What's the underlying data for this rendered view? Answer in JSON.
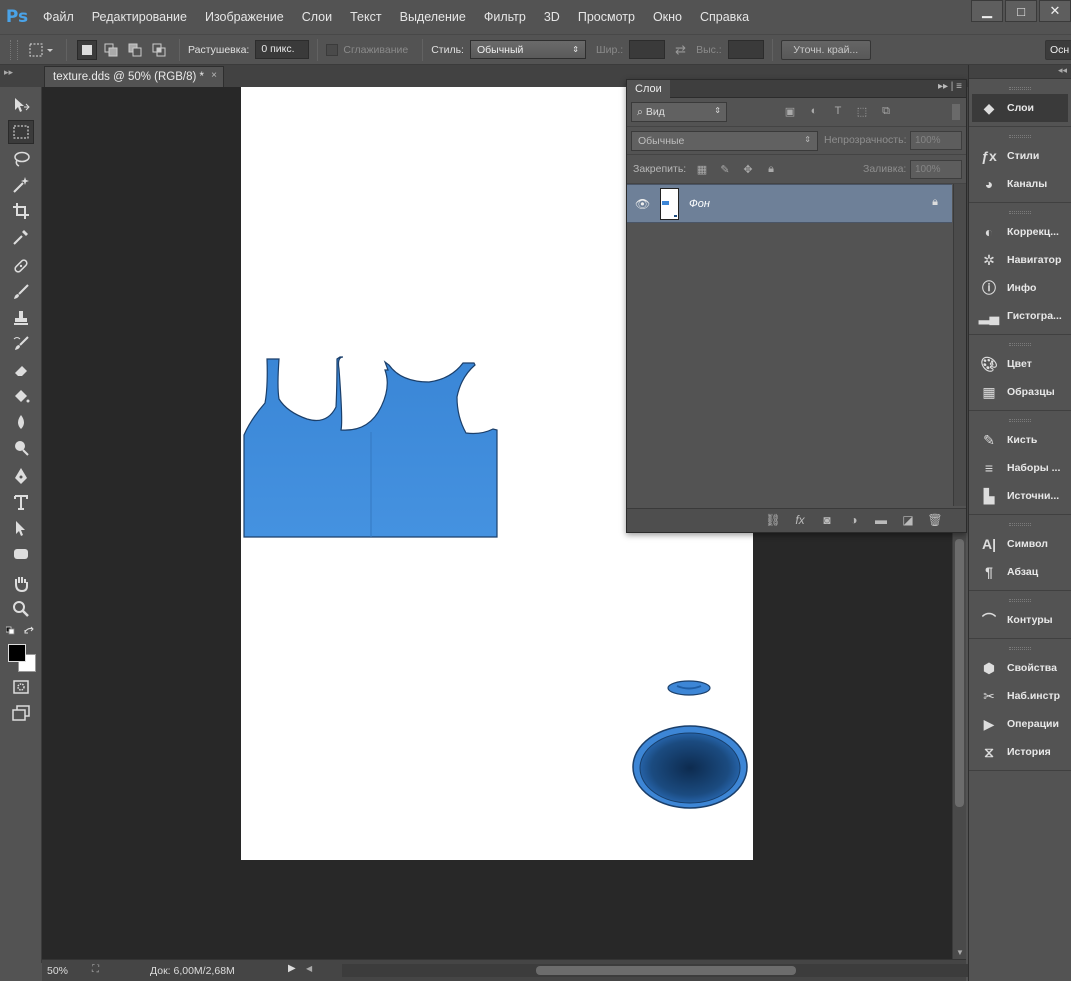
{
  "app": {
    "logo": "Ps"
  },
  "menu": [
    "Файл",
    "Редактирование",
    "Изображение",
    "Слои",
    "Текст",
    "Выделение",
    "Фильтр",
    "3D",
    "Просмотр",
    "Окно",
    "Справка"
  ],
  "window_controls": {
    "minimize": "▁",
    "maximize": "□",
    "close": "✕"
  },
  "options": {
    "feather_label": "Растушевка:",
    "feather_value": "0 пикс.",
    "antialias_label": "Сглаживание",
    "style_label": "Стиль:",
    "style_value": "Обычный",
    "width_label": "Шир.:",
    "height_label": "Выс.:",
    "refine_button": "Уточн. край...",
    "workspace_button": "Осн"
  },
  "document_tab": {
    "title": "texture.dds @ 50% (RGB/8) *",
    "close": "×"
  },
  "layers_panel": {
    "tab": "Слои",
    "filter_value": "Вид",
    "blend_mode": "Обычные",
    "opacity_label": "Непрозрачность:",
    "opacity_value": "100%",
    "lock_label": "Закрепить:",
    "fill_label": "Заливка:",
    "fill_value": "100%",
    "layers": [
      {
        "name": "Фон",
        "visible": true,
        "locked": true
      }
    ]
  },
  "dock": {
    "groups": [
      [
        {
          "label": "Слои",
          "icon": "layers-icon",
          "active": true
        }
      ],
      [
        {
          "label": "Стили",
          "icon": "styles-icon"
        },
        {
          "label": "Каналы",
          "icon": "channels-icon"
        }
      ],
      [
        {
          "label": "Коррекц...",
          "icon": "adjustments-icon"
        },
        {
          "label": "Навигатор",
          "icon": "navigator-icon"
        },
        {
          "label": "Инфо",
          "icon": "info-icon"
        },
        {
          "label": "Гистогра...",
          "icon": "histogram-icon"
        }
      ],
      [
        {
          "label": "Цвет",
          "icon": "color-icon"
        },
        {
          "label": "Образцы",
          "icon": "swatches-icon"
        }
      ],
      [
        {
          "label": "Кисть",
          "icon": "brush-icon"
        },
        {
          "label": "Наборы ...",
          "icon": "brush-presets-icon"
        },
        {
          "label": "Источни...",
          "icon": "clone-source-icon"
        }
      ],
      [
        {
          "label": "Символ",
          "icon": "character-icon"
        },
        {
          "label": "Абзац",
          "icon": "paragraph-icon"
        }
      ],
      [
        {
          "label": "Контуры",
          "icon": "paths-icon"
        }
      ],
      [
        {
          "label": "Свойства",
          "icon": "properties-icon"
        },
        {
          "label": "Наб.инстр",
          "icon": "tool-presets-icon"
        },
        {
          "label": "Операции",
          "icon": "actions-icon"
        },
        {
          "label": "История",
          "icon": "history-icon"
        }
      ]
    ]
  },
  "status": {
    "zoom": "50%",
    "doc_info": "Док: 6,00M/2,68M"
  },
  "colors": {
    "foreground": "#000000",
    "background": "#ffffff",
    "garment_blue": "#3d8ede"
  }
}
